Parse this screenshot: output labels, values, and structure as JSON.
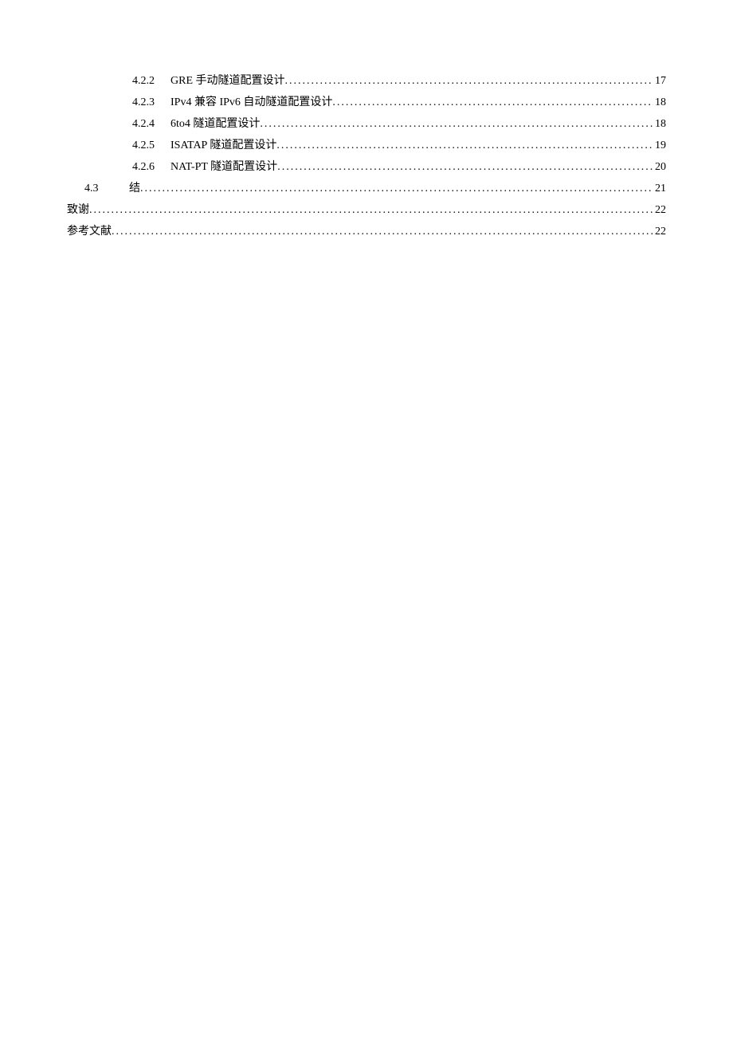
{
  "toc": [
    {
      "level": 3,
      "num": "4.2.2",
      "title": "GRE 手动隧道配置设计",
      "page": "17"
    },
    {
      "level": 3,
      "num": "4.2.3",
      "title": "IPv4 兼容 IPv6 自动隧道配置设计",
      "page": "18"
    },
    {
      "level": 3,
      "num": "4.2.4",
      "title": "6to4 隧道配置设计",
      "page": "18"
    },
    {
      "level": 3,
      "num": "4.2.5",
      "title": "ISATAP 隧道配置设计",
      "page": "19"
    },
    {
      "level": 3,
      "num": "4.2.6",
      "title": "NAT-PT 隧道配置设计",
      "page": "20"
    },
    {
      "level": 2,
      "num": "4.3",
      "title": "结",
      "page": "21"
    },
    {
      "level": 1,
      "num": "",
      "title": "致谢",
      "page": "22"
    },
    {
      "level": 1,
      "num": "",
      "title": "参考文献",
      "page": "22"
    }
  ]
}
